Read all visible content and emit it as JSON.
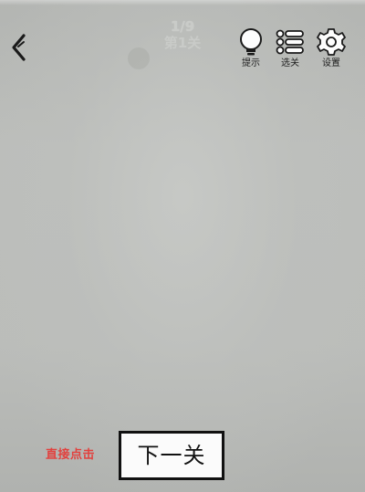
{
  "header": {
    "level_counter": "1/9",
    "level_title": "第1关"
  },
  "toolbar": {
    "hint_label": "提示",
    "levels_label": "选关",
    "settings_label": "设置"
  },
  "footer": {
    "instruction": "直接点击",
    "next_level_label": "下一关"
  },
  "colors": {
    "background": "#b7b9b6",
    "instruction_text": "#e2413e",
    "button_border": "#111111",
    "button_fill": "#fbfbfb"
  },
  "icons": {
    "back": "chevron-left-icon",
    "hint": "lightbulb-icon",
    "levels": "list-icon",
    "settings": "gear-icon"
  }
}
